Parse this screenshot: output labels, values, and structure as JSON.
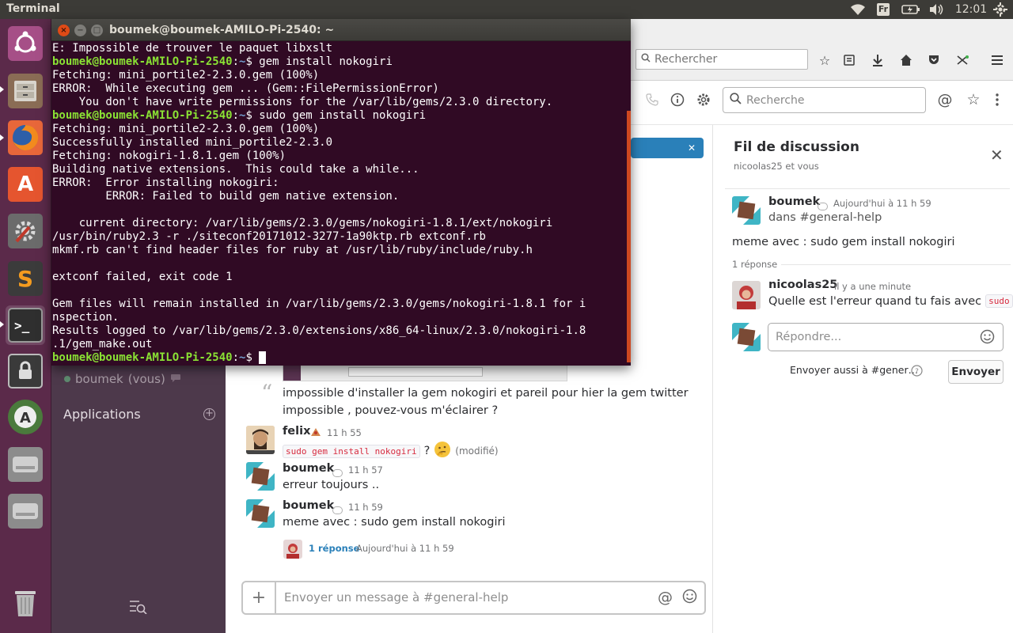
{
  "top_panel": {
    "app_title": "Terminal",
    "keyboard_layout": "Fr",
    "clock": "12:01"
  },
  "launcher": {
    "items": [
      {
        "name": "ubuntu-dash-icon"
      },
      {
        "name": "files-icon"
      },
      {
        "name": "firefox-icon"
      },
      {
        "name": "software-center-icon"
      },
      {
        "name": "system-settings-icon"
      },
      {
        "name": "sublime-text-icon"
      },
      {
        "name": "terminal-icon"
      },
      {
        "name": "lock-screen-icon"
      },
      {
        "name": "software-updater-icon"
      },
      {
        "name": "drive-icon"
      },
      {
        "name": "drive-icon"
      },
      {
        "name": "trash-icon"
      }
    ]
  },
  "firefox": {
    "search_placeholder": "Rechercher"
  },
  "terminal": {
    "title": "boumek@boumek-AMILO-Pi-2540: ~",
    "prompt_user": "boumek@boumek-AMILO-Pi-2540",
    "prompt_path": "~",
    "lines": [
      {
        "type": "out",
        "text": "E: Impossible de trouver le paquet libxslt"
      },
      {
        "type": "cmd",
        "text": "gem install nokogiri"
      },
      {
        "type": "out",
        "text": "Fetching: mini_portile2-2.3.0.gem (100%)"
      },
      {
        "type": "out",
        "text": "ERROR:  While executing gem ... (Gem::FilePermissionError)"
      },
      {
        "type": "out",
        "text": "    You don't have write permissions for the /var/lib/gems/2.3.0 directory."
      },
      {
        "type": "cmd",
        "text": "sudo gem install nokogiri"
      },
      {
        "type": "out",
        "text": "Fetching: mini_portile2-2.3.0.gem (100%)"
      },
      {
        "type": "out",
        "text": "Successfully installed mini_portile2-2.3.0"
      },
      {
        "type": "out",
        "text": "Fetching: nokogiri-1.8.1.gem (100%)"
      },
      {
        "type": "out",
        "text": "Building native extensions.  This could take a while..."
      },
      {
        "type": "out",
        "text": "ERROR:  Error installing nokogiri:"
      },
      {
        "type": "out",
        "text": "        ERROR: Failed to build gem native extension."
      },
      {
        "type": "out",
        "text": ""
      },
      {
        "type": "out",
        "text": "    current directory: /var/lib/gems/2.3.0/gems/nokogiri-1.8.1/ext/nokogiri"
      },
      {
        "type": "out",
        "text": "/usr/bin/ruby2.3 -r ./siteconf20171012-3277-1a90ktp.rb extconf.rb"
      },
      {
        "type": "out",
        "text": "mkmf.rb can't find header files for ruby at /usr/lib/ruby/include/ruby.h"
      },
      {
        "type": "out",
        "text": ""
      },
      {
        "type": "out",
        "text": "extconf failed, exit code 1"
      },
      {
        "type": "out",
        "text": ""
      },
      {
        "type": "out",
        "text": "Gem files will remain installed in /var/lib/gems/2.3.0/gems/nokogiri-1.8.1 for i"
      },
      {
        "type": "out",
        "text": "nspection."
      },
      {
        "type": "out",
        "text": "Results logged to /var/lib/gems/2.3.0/extensions/x86_64-linux/2.3.0/nokogiri-1.8"
      },
      {
        "type": "out",
        "text": ".1/gem_make.out"
      },
      {
        "type": "prompt",
        "text": ""
      }
    ]
  },
  "slack": {
    "sidebar": {
      "dm_name": "boumek",
      "dm_suffix": "(vous)",
      "apps_label": "Applications"
    },
    "header": {
      "search_placeholder": "Recherche"
    },
    "messages": {
      "quoted_text_1": "impossible d'installer la gem nokogiri et pareil pour hier la gem twitter",
      "quoted_text_2": "impossible , pouvez-vous m'éclairer ?",
      "felix_author": "felix",
      "felix_time": "11 h 55",
      "felix_code": "sudo gem install nokogiri",
      "felix_after": "?",
      "felix_edited": "(modifié)",
      "m2_author": "boumek",
      "m2_time": "11 h 57",
      "m2_text": "erreur toujours ..",
      "m3_author": "boumek",
      "m3_time": "11 h 59",
      "m3_text": "meme avec : sudo gem install nokogiri",
      "reply_count": "1 réponse",
      "reply_time": "Aujourd'hui à 11 h 59"
    },
    "composer": {
      "placeholder": "Envoyer un message à #general-help"
    },
    "thread": {
      "title": "Fil de discussion",
      "participants": "nicoolas25 et vous",
      "parent_author": "boumek",
      "parent_time": "Aujourd'hui à 11 h 59",
      "parent_channel": "dans #general-help",
      "parent_text": "meme avec : sudo gem install nokogiri",
      "reply_count": "1 réponse",
      "reply_author": "nicoolas25",
      "reply_time": "il y a une minute",
      "reply_text": "Quelle est l'erreur quand tu fais avec",
      "reply_code": "sudo",
      "reply_placeholder": "Répondre...",
      "also_send": "Envoyer aussi à #gener…",
      "send_button": "Envoyer"
    }
  }
}
